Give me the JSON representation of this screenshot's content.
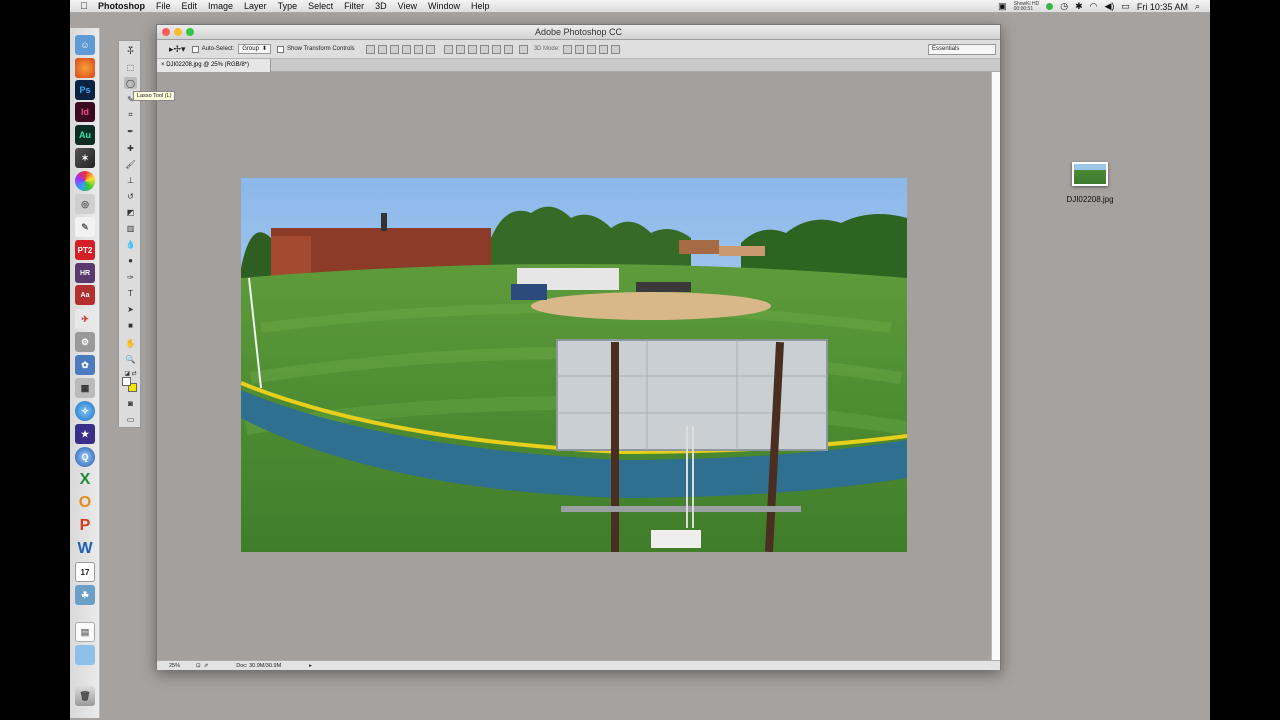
{
  "menubar": {
    "app": "Photoshop",
    "menus": [
      "File",
      "Edit",
      "Image",
      "Layer",
      "Type",
      "Select",
      "Filter",
      "3D",
      "View",
      "Window",
      "Help"
    ],
    "clock": "Fri 10:35 AM",
    "recorder_line1": "ShowKi HD",
    "recorder_line2": "00:00:51"
  },
  "window": {
    "title": "Adobe Photoshop CC"
  },
  "options": {
    "auto_select": "Auto-Select:",
    "auto_select_value": "Group",
    "transform_controls": "Show Transform Controls",
    "mode_3d": "3D Mode:",
    "workspace": "Essentials"
  },
  "document": {
    "tab_label": "DJI02208.jpg @ 25% (RGB/8*)",
    "zoom": "25%",
    "doc_size": "Doc: 30.9M/30.9M"
  },
  "tooltip": "Lasso Tool (L)",
  "desktop": {
    "file_label": "DJI02208.jpg"
  },
  "colors": {
    "sky": "#9cc6ea",
    "grass": "#4f8b34",
    "infield": "#d8b889",
    "fence": "#2f6f8f",
    "fence_top": "#e8cf1b"
  },
  "dock_icons": [
    "finder-icon",
    "firefox-icon",
    "photoshop-icon",
    "indesign-icon",
    "audition-icon",
    "final-cut-icon",
    "color-wheel-icon",
    "scanner-icon",
    "pages-icon",
    "pt2-icon",
    "hr-icon",
    "aa-icon",
    "preview-icon",
    "settings-icon",
    "photo-icon",
    "calculator-icon",
    "safari-icon",
    "imovie-icon",
    "quicktime-icon",
    "excel-icon",
    "outlook-icon",
    "powerpoint-icon",
    "word-icon",
    "calendar-icon",
    "photos-icon",
    "document-icon",
    "folder-icon",
    "trash-icon"
  ]
}
